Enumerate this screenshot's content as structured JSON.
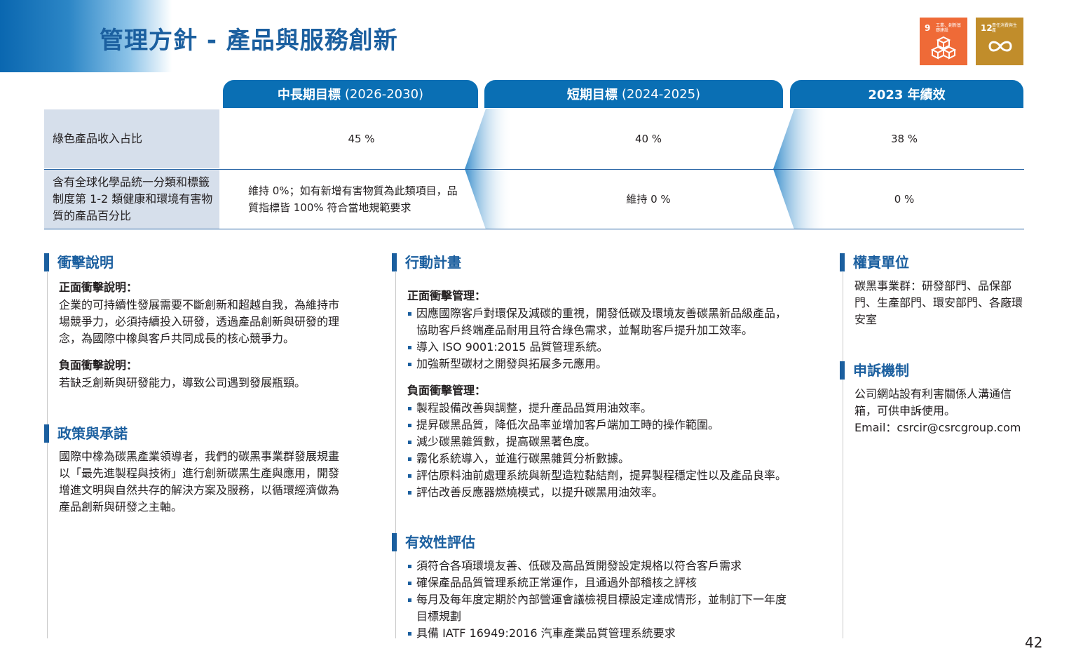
{
  "header": {
    "title": "管理方針 - 產品與服務創新",
    "sdg_icons": [
      {
        "number": "9",
        "label": "工業、創新基礎建設",
        "color": "#ef6a37",
        "icon": "cubes-icon"
      },
      {
        "number": "12",
        "label": "責任消費與生產",
        "color": "#c18d2b",
        "icon": "infinity-icon"
      }
    ]
  },
  "table": {
    "columns": [
      {
        "title": "中長期目標",
        "years": "(2026-2030)"
      },
      {
        "title": "短期目標",
        "years": "(2024-2025)"
      },
      {
        "title": "2023 年績效",
        "years": ""
      }
    ],
    "rows": [
      {
        "label": "綠色產品收入占比",
        "values": [
          "45 %",
          "40 %",
          "38 %"
        ]
      },
      {
        "label": "含有全球化學品統一分類和標籤制度第 1-2 類健康和環境有害物質的產品百分比",
        "values": [
          "維持 0%；如有新增有害物質為此類項目，品質指標皆 100% 符合當地規範要求",
          "維持 0 %",
          "0 %"
        ]
      }
    ]
  },
  "impact": {
    "title": "衝擊說明",
    "positive_label": "正面衝擊說明：",
    "positive_text": "企業的可持續性發展需要不斷創新和超越自我，為維持市場競爭力，必須持續投入研發，透過產品創新與研發的理念，為國際中橡與客戶共同成長的核心競爭力。",
    "negative_label": "負面衝擊說明：",
    "negative_text": "若缺乏創新與研發能力，導致公司遇到發展瓶頸。"
  },
  "policy": {
    "title": "政策與承諾",
    "text": "國際中橡為碳黑產業領導者，我們的碳黑事業群發展規畫以「最先進製程與技術」進行創新碳黑生產與應用，開發增進文明與自然共存的解決方案及服務，以循環經濟做為產品創新與研發之主軸。"
  },
  "action": {
    "title": "行動計畫",
    "positive_label": "正面衝擊管理：",
    "positive_items": [
      "因應國際客戶對環保及減碳的重視，開發低碳及環境友善碳黑新品級產品，協助客戶終端產品耐用且符合綠色需求，並幫助客戶提升加工效率。",
      "導入 ISO 9001:2015 品質管理系統。",
      "加強新型碳材之開發與拓展多元應用。"
    ],
    "negative_label": "負面衝擊管理：",
    "negative_items": [
      "製程設備改善與調整，提升產品品質用油效率。",
      "提昇碳黑品質，降低次品率並增加客戶端加工時的操作範圍。",
      "減少碳黑雜質數，提高碳黑著色度。",
      "霧化系統導入，並進行碳黑雜質分析數據。",
      "評估原料油前處理系統與新型造粒黏結劑，提昇製程穩定性以及產品良率。",
      "評估改善反應器燃燒模式，以提升碳黑用油效率。"
    ]
  },
  "effectiveness": {
    "title": "有效性評估",
    "items": [
      "須符合各項環境友善、低碳及高品質開發設定規格以符合客戶需求",
      "確保產品品質管理系統正常運作，且通過外部稽核之評核",
      "每月及每年度定期於內部營運會議檢視目標設定達成情形，並制訂下一年度目標規劃",
      "具備 IATF 16949:2016 汽車產業品質管理系統要求"
    ]
  },
  "responsibility": {
    "title": "權責單位",
    "text": "碳黑事業群：研發部門、品保部門、生產部門、環安部門、各廠環安室"
  },
  "grievance": {
    "title": "申訴機制",
    "text": "公司網站設有利害關係人溝通信箱，可供申訴使用。",
    "email": "Email：csrcir@csrcgroup.com"
  },
  "page_number": "42"
}
